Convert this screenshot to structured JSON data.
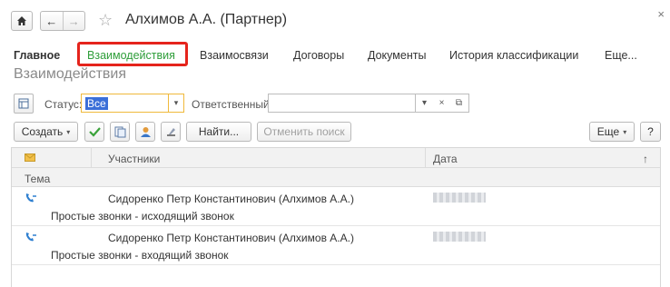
{
  "window": {
    "title": "Алхимов А.А. (Партнер)",
    "close_glyph": "×"
  },
  "nav": {
    "home_icon": "home-icon",
    "back_glyph": "←",
    "forward_glyph": "→",
    "favorite_glyph": "☆"
  },
  "tabs": [
    {
      "label": "Главное",
      "active": false,
      "main": true
    },
    {
      "label": "Взаимодействия",
      "active": true,
      "main": false
    },
    {
      "label": "Взаимосвязи",
      "active": false,
      "main": false
    },
    {
      "label": "Договоры",
      "active": false,
      "main": false
    },
    {
      "label": "Документы",
      "active": false,
      "main": false
    },
    {
      "label": "История классификации",
      "active": false,
      "main": false
    },
    {
      "label": "Еще...",
      "active": false,
      "main": false
    }
  ],
  "page_title": "Взаимодействия",
  "filters": {
    "status_label": "Статус:",
    "status_value": "Все",
    "responsible_label": "Ответственный:",
    "responsible_value": ""
  },
  "toolbar": {
    "create_label": "Создать",
    "find_label": "Найти...",
    "cancel_search_label": "Отменить поиск",
    "more_label": "Еще",
    "help_label": "?"
  },
  "table": {
    "columns": [
      "Участники",
      "Дата"
    ],
    "sort_glyph": "↑",
    "subheader": "Тема",
    "rows": [
      {
        "participants": "Сидоренко Петр Константинович (Алхимов А.А.)",
        "subject": "Простые звонки - исходящий звонок"
      },
      {
        "participants": "Сидоренко Петр Константинович (Алхимов А.А.)",
        "subject": "Простые звонки - входящий звонок"
      }
    ]
  },
  "colors": {
    "accent_green": "#2f9e3a",
    "highlight_red": "#e5241c",
    "selection_blue": "#3b6fd8",
    "focus_yellow": "#f0b93b"
  }
}
